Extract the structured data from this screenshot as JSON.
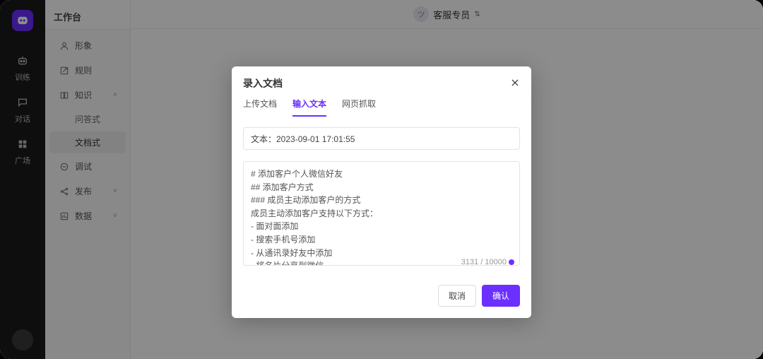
{
  "rail": {
    "items": [
      {
        "label": "训练"
      },
      {
        "label": "对话"
      },
      {
        "label": "广场"
      }
    ]
  },
  "sidebar": {
    "title": "工作台",
    "items": [
      {
        "label": "形象"
      },
      {
        "label": "规则"
      },
      {
        "label": "知识"
      },
      {
        "label": "调试"
      },
      {
        "label": "发布"
      },
      {
        "label": "数据"
      }
    ],
    "knowledge_children": [
      {
        "label": "问答式"
      },
      {
        "label": "文档式"
      }
    ]
  },
  "topbar": {
    "title": "客服专员",
    "avatar_glyph": "ツ"
  },
  "modal": {
    "title": "录入文档",
    "tabs": [
      {
        "label": "上传文档"
      },
      {
        "label": "输入文本"
      },
      {
        "label": "网页抓取"
      }
    ],
    "title_input": "文本：2023-09-01 17:01:55",
    "body_text": "# 添加客户个人微信好友\n## 添加客户方式\n### 成员主动添加客户的方式\n成员主动添加客户支持以下方式：\n- 面对面添加\n- 搜索手机号添加\n- 从通讯录好友中添加\n- 将名片分享到微信\n- 互通群中点击群成员好友详情发起添加\n- 通过好友名片添加",
    "counter": "3131 / 10000",
    "cancel": "取消",
    "confirm": "确认"
  }
}
